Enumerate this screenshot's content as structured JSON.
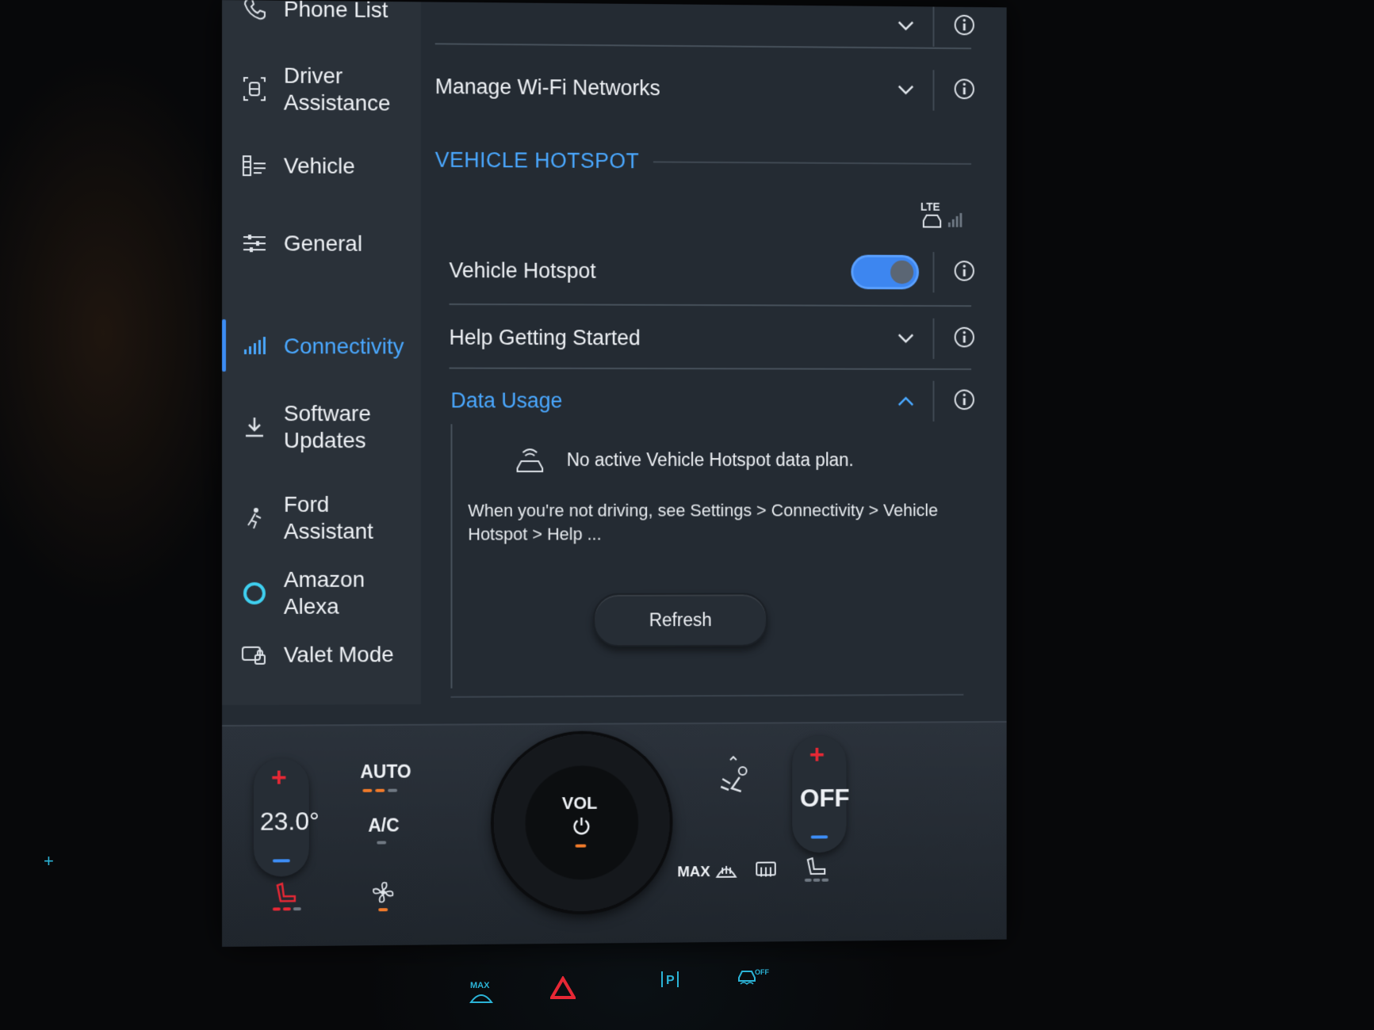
{
  "sidebar": {
    "items": [
      {
        "label": "Phone List",
        "icon": "phone-icon"
      },
      {
        "label": "Driver Assistance",
        "icon": "driver-assist-icon"
      },
      {
        "label": "Vehicle",
        "icon": "vehicle-icon"
      },
      {
        "label": "General",
        "icon": "sliders-icon"
      },
      {
        "label": "Connectivity",
        "icon": "signal-bars-icon",
        "active": true
      },
      {
        "label": "Software Updates",
        "icon": "download-icon"
      },
      {
        "label": "Ford Assistant",
        "icon": "assistant-icon"
      },
      {
        "label": "Amazon Alexa",
        "icon": "alexa-ring-icon"
      },
      {
        "label": "Valet Mode",
        "icon": "valet-icon"
      }
    ]
  },
  "content": {
    "manage_wifi": "Manage Wi-Fi Networks",
    "section_title": "VEHICLE HOTSPOT",
    "lte_label": "LTE",
    "hotspot": {
      "label": "Vehicle Hotspot",
      "enabled": true
    },
    "help": "Help Getting Started",
    "data_usage": {
      "label": "Data Usage",
      "plan_message": "No active Vehicle Hotspot data plan.",
      "help_text": "When you're not driving, see Settings > Connectivity > Vehicle Hotspot > Help ...",
      "refresh": "Refresh"
    }
  },
  "climate": {
    "temperature": "23.0°",
    "auto": "AUTO",
    "ac": "A/C",
    "vol": "VOL",
    "right_temp": "OFF",
    "max_defrost": "MAX"
  },
  "colors": {
    "accent": "#4aa8ff",
    "toggle": "#3d86f0",
    "heat_red": "#e62835",
    "cool_blue": "#3d8df5"
  }
}
